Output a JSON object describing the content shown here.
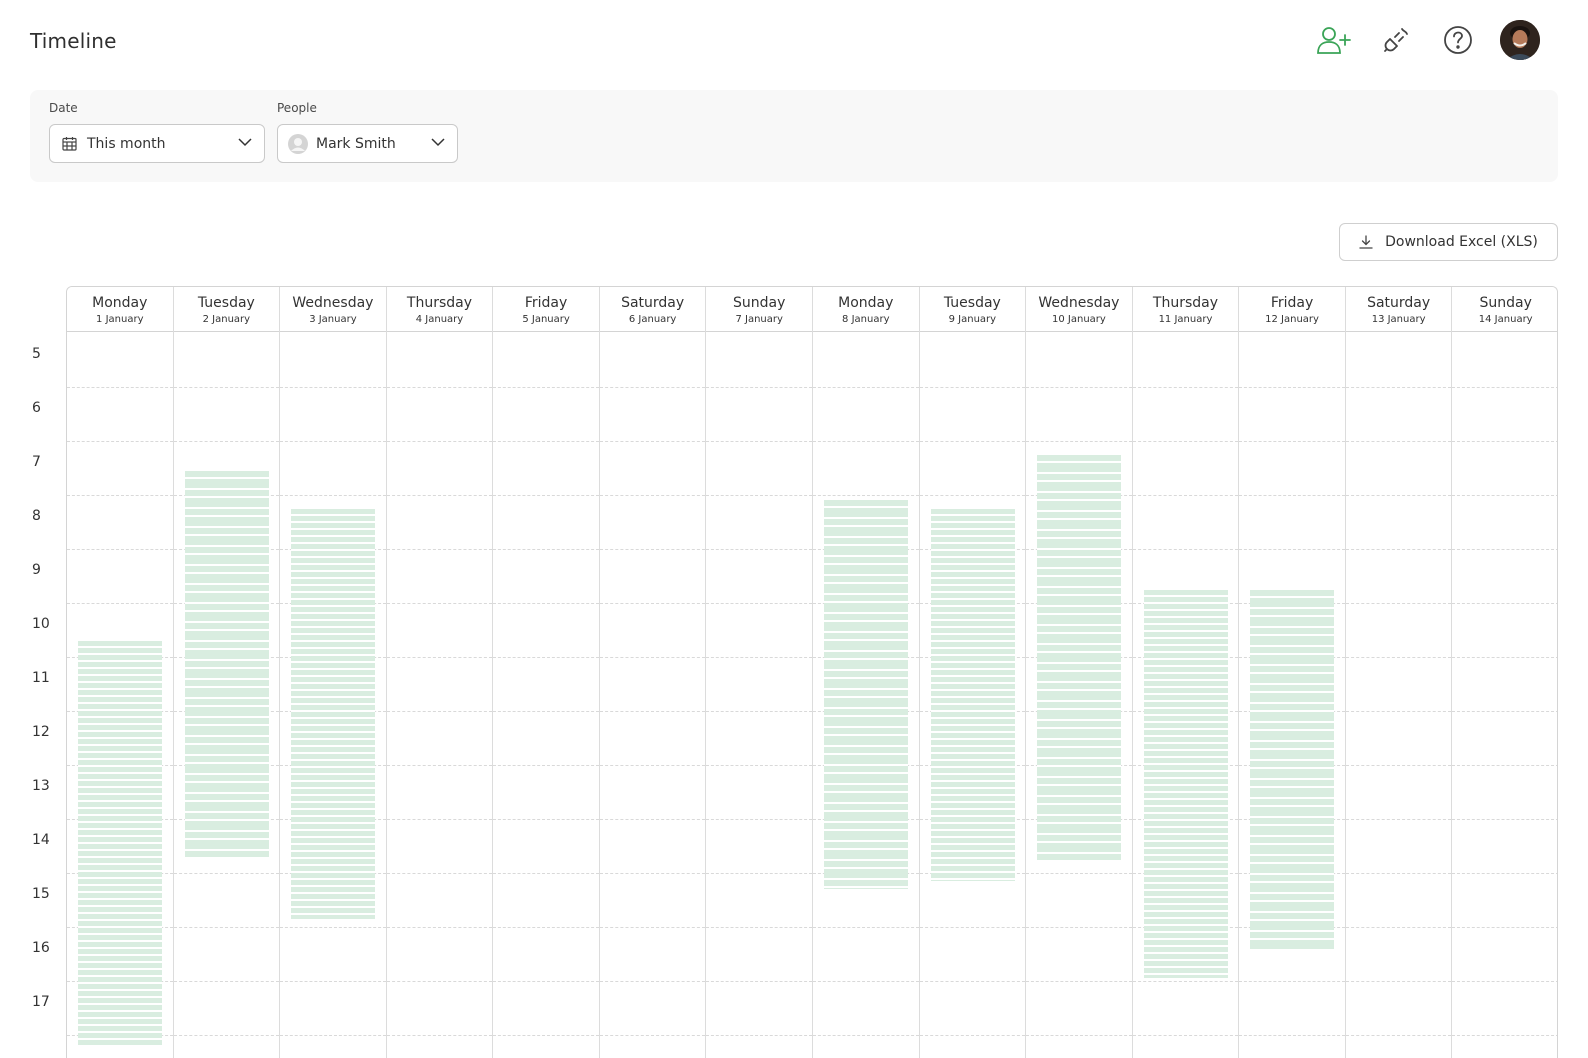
{
  "header": {
    "title": "Timeline",
    "actions": [
      {
        "icon": "add-user-icon",
        "color": "#3aa457"
      },
      {
        "icon": "plug-icon",
        "color": "#444444"
      },
      {
        "icon": "help-icon",
        "color": "#444444"
      }
    ],
    "avatar": "user-avatar"
  },
  "filters": {
    "date": {
      "label": "Date",
      "value": "This month",
      "icon": "calendar-icon"
    },
    "people": {
      "label": "People",
      "value": "Mark Smith",
      "icon": "person-icon"
    }
  },
  "download": {
    "label": "Download Excel (XLS)",
    "icon": "download-icon"
  },
  "timeline": {
    "accent": "#d9ede0",
    "hours": [
      "5",
      "6",
      "7",
      "8",
      "9",
      "10",
      "11",
      "12",
      "13",
      "14",
      "15",
      "16",
      "17"
    ],
    "days": [
      {
        "name": "Monday",
        "date": "1 January",
        "start": 10.2,
        "end": 17.7
      },
      {
        "name": "Tuesday",
        "date": "2 January",
        "start": 7.05,
        "end": 14.25
      },
      {
        "name": "Wednesday",
        "date": "3 January",
        "start": 7.75,
        "end": 15.35
      },
      {
        "name": "Thursday",
        "date": "4 January"
      },
      {
        "name": "Friday",
        "date": "5 January"
      },
      {
        "name": "Saturday",
        "date": "6 January"
      },
      {
        "name": "Sunday",
        "date": "7 January"
      },
      {
        "name": "Monday",
        "date": "8 January",
        "start": 7.6,
        "end": 14.8
      },
      {
        "name": "Tuesday",
        "date": "9 January",
        "start": 7.75,
        "end": 14.65
      },
      {
        "name": "Wednesday",
        "date": "10 January",
        "start": 6.75,
        "end": 14.25
      },
      {
        "name": "Thursday",
        "date": "11 January",
        "start": 9.25,
        "end": 16.45
      },
      {
        "name": "Friday",
        "date": "12 January",
        "start": 9.25,
        "end": 15.95
      },
      {
        "name": "Saturday",
        "date": "13 January"
      },
      {
        "name": "Sunday",
        "date": "14 January"
      }
    ]
  }
}
